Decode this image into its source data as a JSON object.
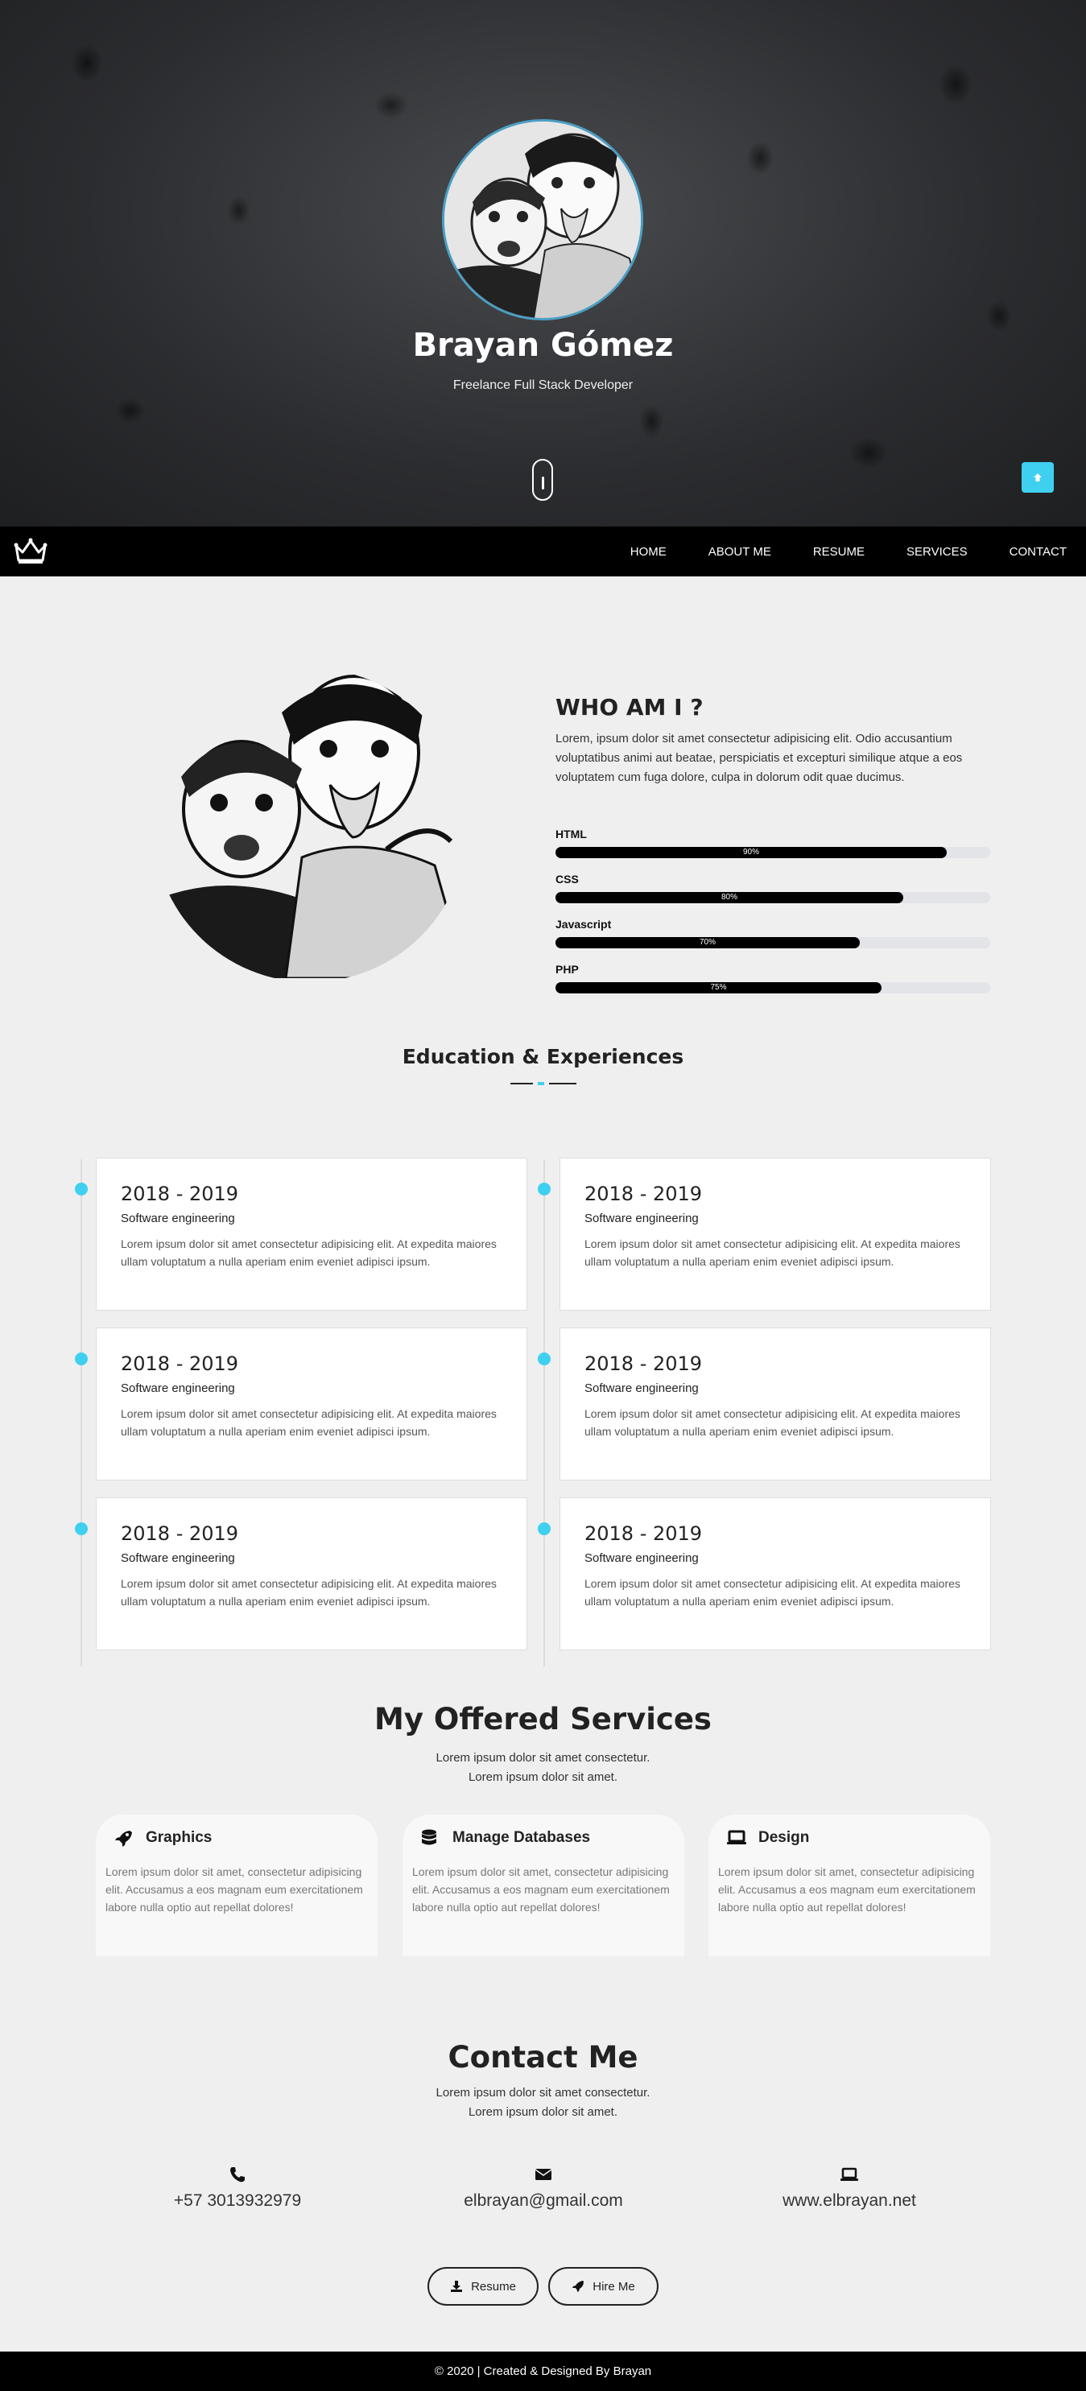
{
  "hero": {
    "name": "Brayan Gómez",
    "subtitle": "Freelance Full Stack Developer"
  },
  "nav": {
    "items": [
      {
        "label": "HOME"
      },
      {
        "label": "ABOUT ME"
      },
      {
        "label": "RESUME"
      },
      {
        "label": "SERVICES"
      },
      {
        "label": "CONTACT"
      }
    ]
  },
  "about": {
    "title": "WHO AM I ?",
    "text": "Lorem, ipsum dolor sit amet consectetur adipisicing elit. Odio accusantium voluptatibus animi aut beatae, perspiciatis et excepturi similique atque a eos voluptatem cum fuga dolore, culpa in dolorum odit quae ducimus.",
    "skills": [
      {
        "name": "HTML",
        "percent": 90,
        "label": "90%"
      },
      {
        "name": "CSS",
        "percent": 80,
        "label": "80%"
      },
      {
        "name": "Javascript",
        "percent": 70,
        "label": "70%"
      },
      {
        "name": "PHP",
        "percent": 75,
        "label": "75%"
      }
    ]
  },
  "education": {
    "title": "Education & Experiences",
    "entries": [
      {
        "years": "2018 - 2019",
        "role": "Software engineering",
        "text": "Lorem ipsum dolor sit amet consectetur adipisicing elit. At expedita maiores ullam voluptatum a nulla aperiam enim eveniet adipisci ipsum."
      },
      {
        "years": "2018 - 2019",
        "role": "Software engineering",
        "text": "Lorem ipsum dolor sit amet consectetur adipisicing elit. At expedita maiores ullam voluptatum a nulla aperiam enim eveniet adipisci ipsum."
      },
      {
        "years": "2018 - 2019",
        "role": "Software engineering",
        "text": "Lorem ipsum dolor sit amet consectetur adipisicing elit. At expedita maiores ullam voluptatum a nulla aperiam enim eveniet adipisci ipsum."
      },
      {
        "years": "2018 - 2019",
        "role": "Software engineering",
        "text": "Lorem ipsum dolor sit amet consectetur adipisicing elit. At expedita maiores ullam voluptatum a nulla aperiam enim eveniet adipisci ipsum."
      },
      {
        "years": "2018 - 2019",
        "role": "Software engineering",
        "text": "Lorem ipsum dolor sit amet consectetur adipisicing elit. At expedita maiores ullam voluptatum a nulla aperiam enim eveniet adipisci ipsum."
      },
      {
        "years": "2018 - 2019",
        "role": "Software engineering",
        "text": "Lorem ipsum dolor sit amet consectetur adipisicing elit. At expedita maiores ullam voluptatum a nulla aperiam enim eveniet adipisci ipsum."
      }
    ]
  },
  "services": {
    "title": "My Offered Services",
    "subtitle_line1": "Lorem ipsum dolor sit amet consectetur.",
    "subtitle_line2": "Lorem ipsum dolor sit amet.",
    "items": [
      {
        "icon": "rocket-icon",
        "title": "Graphics",
        "text": "Lorem ipsum dolor sit amet, consectetur adipisicing elit. Accusamus a eos magnam eum exercitationem labore nulla optio aut repellat dolores!"
      },
      {
        "icon": "database-icon",
        "title": "Manage Databases",
        "text": "Lorem ipsum dolor sit amet, consectetur adipisicing elit. Accusamus a eos magnam eum exercitationem labore nulla optio aut repellat dolores!"
      },
      {
        "icon": "laptop-icon",
        "title": "Design",
        "text": "Lorem ipsum dolor sit amet, consectetur adipisicing elit. Accusamus a eos magnam eum exercitationem labore nulla optio aut repellat dolores!"
      }
    ]
  },
  "contact": {
    "title": "Contact Me",
    "subtitle_line1": "Lorem ipsum dolor sit amet consectetur.",
    "subtitle_line2": "Lorem ipsum dolor sit amet.",
    "phone": "+57 3013932979",
    "email": "elbrayan@gmail.com",
    "website": "www.elbrayan.net",
    "resume_label": "Resume",
    "hire_label": "Hire Me"
  },
  "footer": {
    "text": "© 2020 | Created & Designed By Brayan"
  },
  "colors": {
    "accent": "#3fd0f0",
    "nav_bg": "#000000",
    "page_bg": "#efefef"
  }
}
